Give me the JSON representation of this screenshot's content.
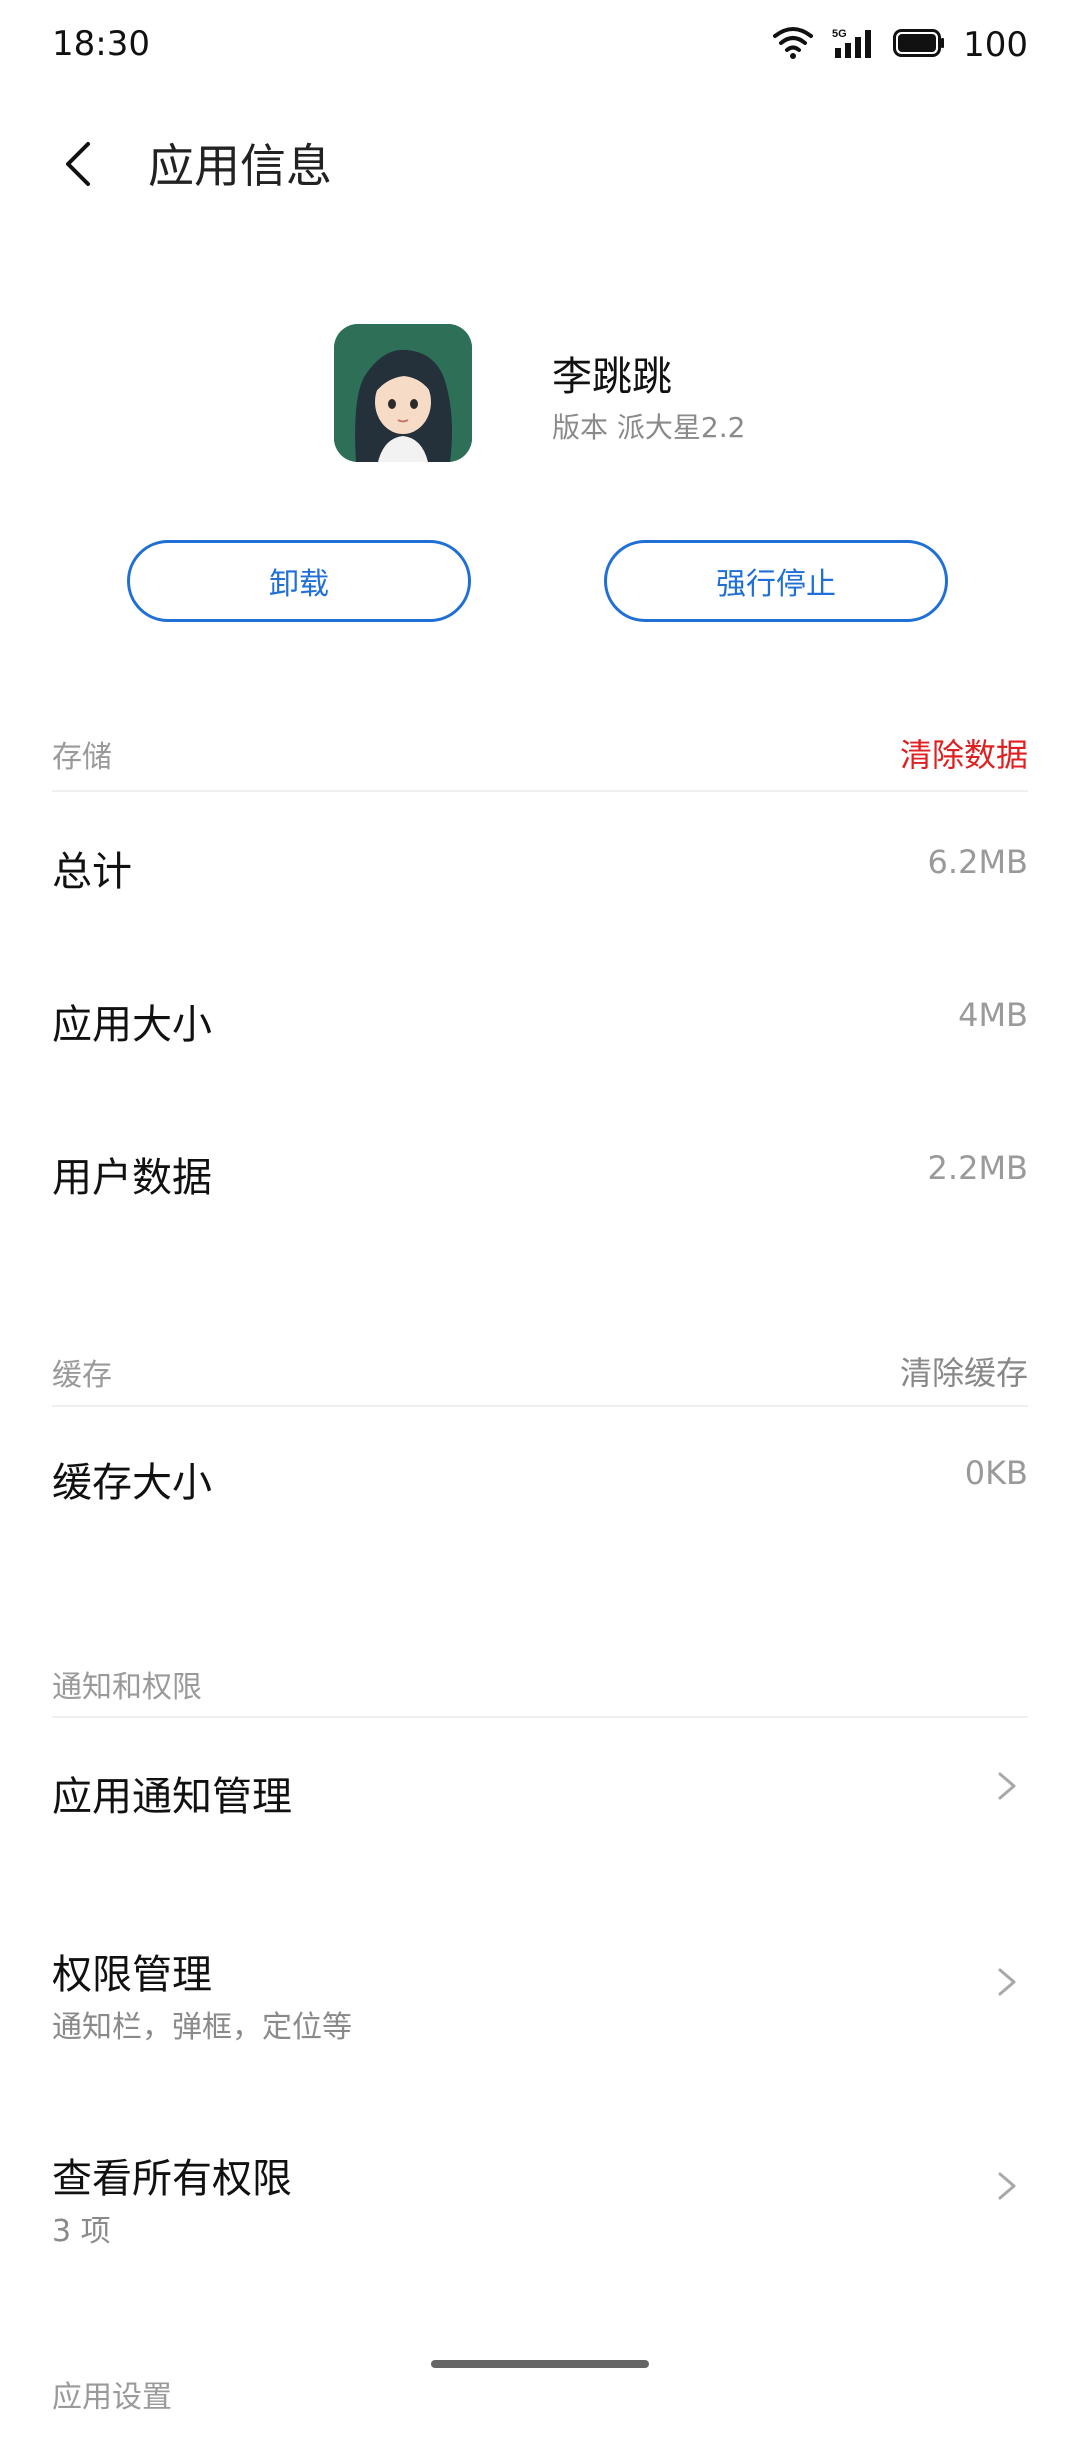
{
  "status_bar": {
    "time": "18:30",
    "signal_label": "5G",
    "battery": "100"
  },
  "header": {
    "title": "应用信息"
  },
  "app": {
    "name": "李跳跳",
    "version": "版本 派大星2.2"
  },
  "buttons": {
    "uninstall": "卸载",
    "force_stop": "强行停止"
  },
  "storage": {
    "title": "存储",
    "action": "清除数据",
    "action_color": "#e02020",
    "rows": [
      {
        "label": "总计",
        "value": "6.2MB"
      },
      {
        "label": "应用大小",
        "value": "4MB"
      },
      {
        "label": "用户数据",
        "value": "2.2MB"
      }
    ]
  },
  "cache": {
    "title": "缓存",
    "action": "清除缓存",
    "rows": [
      {
        "label": "缓存大小",
        "value": "0KB"
      }
    ]
  },
  "notify": {
    "title": "通知和权限",
    "rows": [
      {
        "label": "应用通知管理",
        "sub": ""
      },
      {
        "label": "权限管理",
        "sub": "通知栏，弹框，定位等"
      },
      {
        "label": "查看所有权限",
        "sub": "3 项"
      }
    ]
  },
  "settings": {
    "title": "应用设置"
  },
  "colors": {
    "accent": "#1f6fd6",
    "danger": "#e02020",
    "icon_bg": "#2d6f57"
  }
}
